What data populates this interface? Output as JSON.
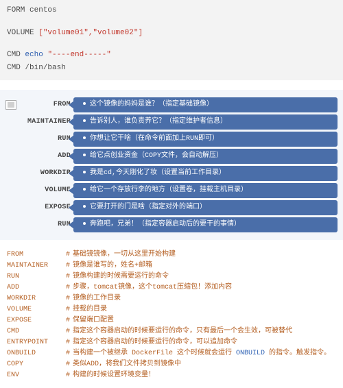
{
  "code": {
    "line1_kw": "FORM",
    "line1_arg": "centos",
    "line2_kw": "VOLUME",
    "line2_arg": "[\"volume01\",\"volume02\"]",
    "line3_kw": "CMD",
    "line3_echo": "echo",
    "line3_arg": "\"----end-----\"",
    "line4_kw": "CMD",
    "line4_arg": "/bin/bash"
  },
  "diagram": [
    {
      "label": "FROM",
      "text": "这个镜像的妈妈是谁？（指定基础镜像）"
    },
    {
      "label": "MAINTAINER",
      "text": "告诉别人，谁负责养它？（指定维护者信息）"
    },
    {
      "label": "RUN",
      "text": "你想让它干啥（在命令前面加上RUN即可）"
    },
    {
      "label": "ADD",
      "text": "给它点创业资金（COPY文件，会自动解压）"
    },
    {
      "label": "WORKDIR",
      "text": "我是cd,今天刚化了妆（设置当前工作目录）"
    },
    {
      "label": "VOLUME",
      "text": "给它一个存放行李的地方（设置卷，挂载主机目录）"
    },
    {
      "label": "EXPOSE",
      "text": "它要打开的门是啥（指定对外的端口）"
    },
    {
      "label": "RUN",
      "text": "奔跑吧，兄弟！（指定容器启动后的要干的事情）"
    }
  ],
  "explain": {
    "hash": "#",
    "rows": [
      {
        "key": "FROM",
        "text": "基础镜镜像，一切从这里开始构建"
      },
      {
        "key": "MAINTAINER",
        "text": "镜像是谁写的，姓名+邮箱"
      },
      {
        "key": "RUN",
        "text": "镜像构建的时候需要运行的命令"
      },
      {
        "key": "ADD",
        "text": "步骤，tomcat镜像，这个tomcat压缩包！添加内容"
      },
      {
        "key": "WORKDIR",
        "text": "镜像的工作目录"
      },
      {
        "key": "VOLUME",
        "text": "挂载的目录"
      },
      {
        "key": "EXPOSE",
        "text": "保留端口配置"
      },
      {
        "key": "CMD",
        "text": "指定这个容器启动的时候要运行的命令，只有最后一个会生效，可被替代"
      },
      {
        "key": "ENTRYPOINT",
        "text": "指定这个容器启动的时候要运行的命令，可以追加命令"
      },
      {
        "key": "ONBUILD",
        "text_pre": "当构建一个被继承 DockerFile 这个时候就会运行 ",
        "hi": "ONBUILD",
        "text_post": "  的指令。触发指令。"
      },
      {
        "key": "COPY",
        "text": "类似ADD，将我们文件拷贝到镜像中"
      },
      {
        "key": "ENV",
        "text": "构建的时候设置环境变量！"
      }
    ]
  }
}
